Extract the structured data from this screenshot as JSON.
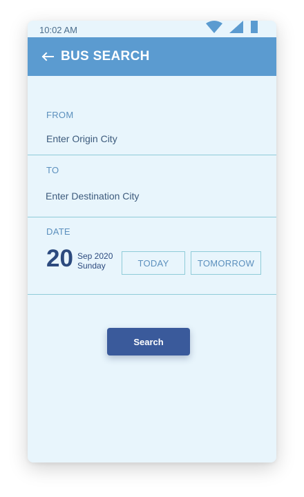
{
  "status_bar": {
    "time": "10:02 AM",
    "icons": [
      "wifi-icon",
      "signal-icon",
      "battery-icon"
    ]
  },
  "app_bar": {
    "back_icon": "arrow-left-icon",
    "title": "BUS SEARCH"
  },
  "form": {
    "from": {
      "label": "FROM",
      "placeholder": "Enter Origin City",
      "value": ""
    },
    "to": {
      "label": "TO",
      "placeholder": "Enter Destination City",
      "value": ""
    },
    "date": {
      "label": "DATE",
      "day": "20",
      "month_year": "Sep 2020",
      "weekday": "Sunday",
      "today_label": "TODAY",
      "tomorrow_label": "TOMORROW"
    },
    "search_label": "Search"
  },
  "colors": {
    "background": "#e8f5fc",
    "app_bar": "#5b9bd0",
    "label": "#5b8fbd",
    "date_text": "#2c4a7e",
    "divider": "#8ecbd8",
    "button": "#3a5a9b"
  }
}
